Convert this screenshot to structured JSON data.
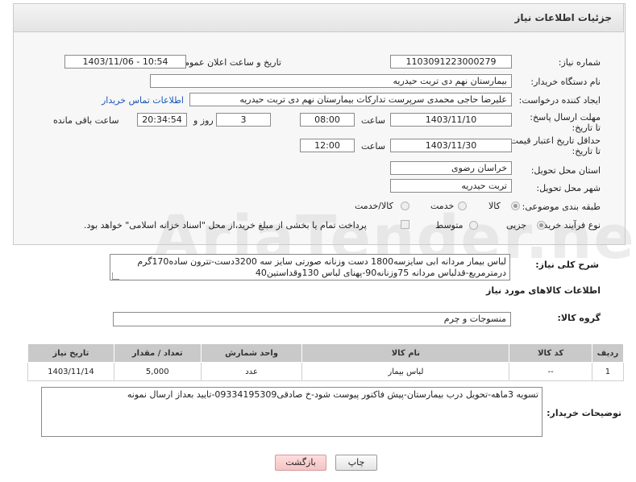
{
  "header": {
    "title": "جزئیات اطلاعات نیاز"
  },
  "form": {
    "need_number_label": "شماره نیاز:",
    "need_number": "1103091223000279",
    "announce_label": "تاریخ و ساعت اعلان عمومی:",
    "announce_value": "1403/11/06 - 10:54",
    "buyer_org_label": "نام دستگاه خریدار:",
    "buyer_org": "بیمارستان نهم دی تربت حیدریه",
    "creator_label": "ایجاد کننده درخواست:",
    "creator": "علیرضا حاجی محمدی سرپرست تدارکات بیمارستان نهم دی تربت حیدریه",
    "contact_link": "اطلاعات تماس خریدار",
    "deadline_label": "مهلت ارسال پاسخ: تا تاریخ:",
    "deadline_date": "1403/11/10",
    "time_label": "ساعت",
    "deadline_time": "08:00",
    "days_value": "3",
    "days_label": "روز و",
    "remaining_time": "20:34:54",
    "remaining_label": "ساعت باقی مانده",
    "validity_label": "حداقل تاریخ اعتبار قیمت: تا تاریخ:",
    "validity_date": "1403/11/30",
    "validity_time": "12:00",
    "province_label": "استان محل تحویل:",
    "province": "خراسان رضوی",
    "city_label": "شهر محل تحویل:",
    "city": "تربت حیدریه",
    "category_label": "طبقه بندی موضوعی:",
    "category_options": [
      "کالا",
      "خدمت",
      "کالا/خدمت"
    ],
    "category_selected": "کالا",
    "process_label": "نوع فرآیند خرید :",
    "process_options": [
      "جزیی",
      "متوسط"
    ],
    "process_selected": "جزیی",
    "payment_note": "پرداخت تمام یا بخشی از مبلغ خرید،از محل \"اسناد خزانه اسلامی\" خواهد بود."
  },
  "description": {
    "label": "شرح کلی نیاز:",
    "text": "لباس بیمار مردانه ابی سایزسه1800 دست وزنانه صورتی سایز سه 3200دست-تترون ساده170گرم درمترمربع-قدلباس مردانه 75وزنانه90-پهنای لباس 130وقداستین40"
  },
  "goods": {
    "section_title": "اطلاعات کالاهای مورد نیاز",
    "group_label": "گروه کالا:",
    "group_value": "منسوجات و چرم",
    "columns": [
      "ردیف",
      "کد کالا",
      "نام کالا",
      "واحد شمارش",
      "تعداد / مقدار",
      "تاریخ نیاز"
    ],
    "rows": [
      [
        "1",
        "--",
        "لباس بیمار",
        "عدد",
        "5,000",
        "1403/11/14"
      ]
    ]
  },
  "notes": {
    "label": "توضیحات خریدار:",
    "text": "تسویه 3ماهه-تحویل درب بیمارستان-پیش فاکتور پیوست شود-خ صادقی09334195309-تایید بعداز ارسال نمونه"
  },
  "buttons": {
    "print": "چاپ",
    "back": "بازگشت"
  },
  "watermark": "AriaTender.neT"
}
